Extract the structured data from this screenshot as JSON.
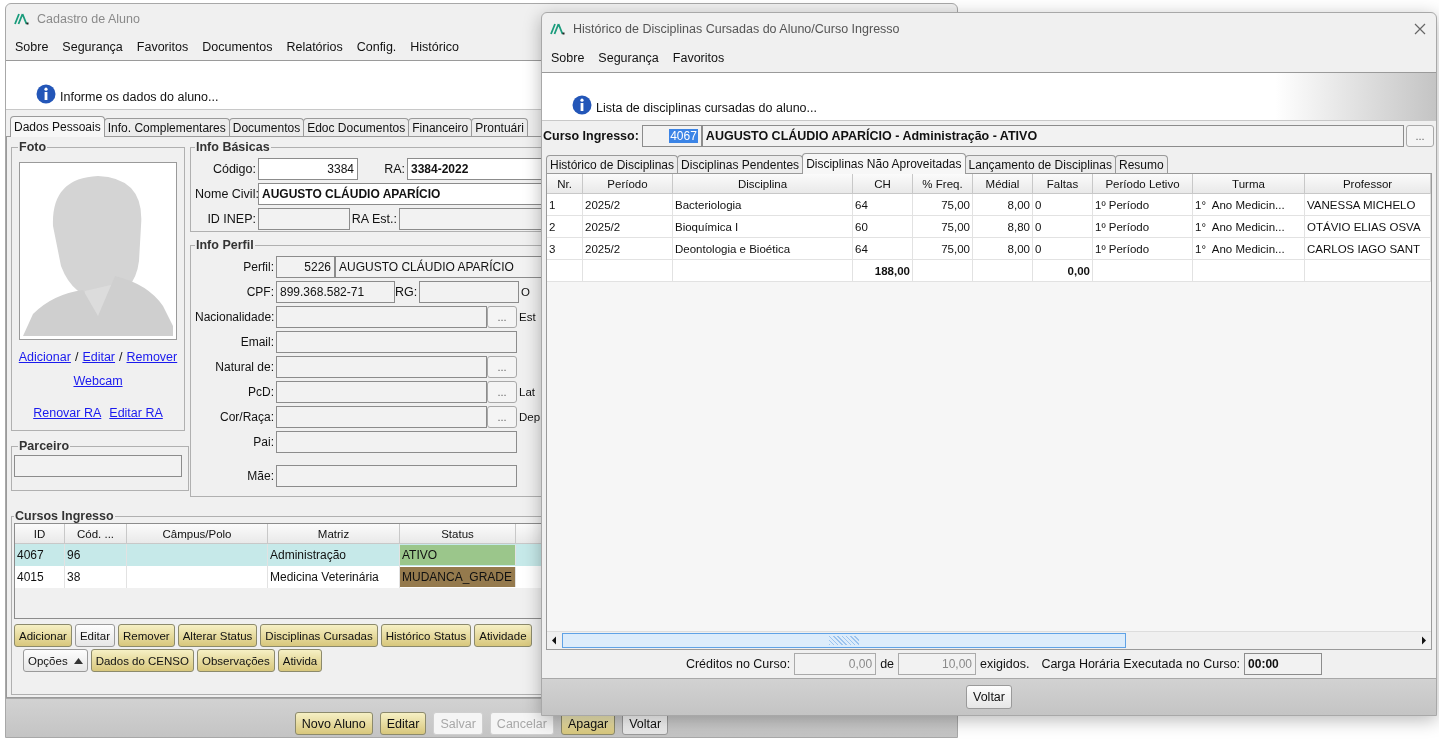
{
  "main_window": {
    "title": "Cadastro de Aluno",
    "menu": [
      "Sobre",
      "Segurança",
      "Favoritos",
      "Documentos",
      "Relatórios",
      "Config.",
      "Histórico"
    ],
    "info_message": "Informe os dados do aluno...",
    "tabs": [
      {
        "label": "Dados Pessoais",
        "selected": true
      },
      {
        "label": "Info. Complementares",
        "selected": false
      },
      {
        "label": "Documentos",
        "selected": false
      },
      {
        "label": "Edoc Documentos",
        "selected": false
      },
      {
        "label": "Financeiro",
        "selected": false
      },
      {
        "label": "Prontuári",
        "selected": false
      }
    ],
    "foto": {
      "title": "Foto",
      "photo_links": [
        {
          "kind": "link",
          "text": "Adicionar"
        },
        {
          "kind": "separator",
          "text": "/"
        },
        {
          "kind": "link",
          "text": "Editar"
        },
        {
          "kind": "separator",
          "text": "/"
        },
        {
          "kind": "link",
          "text": "Remover"
        }
      ],
      "webcam_link": "Webcam",
      "ra_links": [
        "Renovar RA",
        "Editar RA"
      ]
    },
    "parceiro": {
      "title": "Parceiro"
    },
    "info_basicas": {
      "title": "Info Básicas",
      "codigo": {
        "label": "Código:",
        "value": "3384"
      },
      "ra": {
        "label": "RA:",
        "value": "3384-2022"
      },
      "nome_civil": {
        "label": "Nome Civil:",
        "value": "AUGUSTO CLÁUDIO APARÍCIO"
      },
      "id_inep": {
        "label": "ID INEP:"
      },
      "ra_est": {
        "label": "RA Est.:"
      }
    },
    "info_perfil": {
      "title": "Info Perfil",
      "perfil": {
        "label": "Perfil:",
        "code": "5226",
        "name": "AUGUSTO CLÁUDIO APARÍCIO"
      },
      "cpf": {
        "label": "CPF:",
        "value": "899.368.582-71"
      },
      "rg": {
        "label": "RG:",
        "side_label": "O"
      },
      "rows": [
        {
          "kind": "lookup",
          "label": "Nacionalidade:",
          "button": "...",
          "side_label": "Est"
        },
        {
          "kind": "text",
          "label": "Email:"
        },
        {
          "kind": "lookup",
          "label": "Natural de:",
          "button": "..."
        },
        {
          "kind": "lookup",
          "label": "PcD:",
          "button": "...",
          "side_label": "Lat"
        },
        {
          "kind": "lookup",
          "label": "Cor/Raça:",
          "button": "...",
          "side_label": "Dep"
        },
        {
          "kind": "text",
          "label": "Pai:"
        },
        {
          "kind": "text",
          "label": "Mãe:"
        }
      ]
    },
    "cursos_ingresso": {
      "title": "Cursos Ingresso",
      "columns": [
        "ID",
        "Cód. ...",
        "Câmpus/Polo",
        "Matriz",
        "Status"
      ],
      "rows": [
        {
          "id": "4067",
          "cod": "96",
          "matriz": "Administração",
          "status": "ATIVO",
          "color": "#9bc68b",
          "selected": true
        },
        {
          "id": "4015",
          "cod": "38",
          "matriz": "Medicina Veterinária",
          "status": "MUDANCA_GRADE",
          "color": "#957a4d",
          "selected": false
        }
      ],
      "button_rows": [
        [
          {
            "label": "Adicionar",
            "kind": "gold"
          },
          {
            "label": "Editar",
            "kind": "plain"
          },
          {
            "label": "Remover",
            "kind": "gold"
          },
          {
            "label": "Alterar Status",
            "kind": "gold"
          },
          {
            "label": "Disciplinas Cursadas",
            "kind": "gold"
          },
          {
            "label": "Histórico Status",
            "kind": "gold"
          },
          {
            "label": "Atividade",
            "kind": "gold"
          }
        ],
        [
          {
            "label": "Opções",
            "kind": "menu"
          },
          {
            "label": "Dados do CENSO",
            "kind": "gold"
          },
          {
            "label": "Observações",
            "kind": "gold"
          },
          {
            "label": "Ativida",
            "kind": "gold"
          }
        ]
      ]
    },
    "bottom_buttons": [
      {
        "label": "Novo Aluno",
        "kind": "gold",
        "disabled": false
      },
      {
        "label": "Editar",
        "kind": "gold",
        "disabled": false
      },
      {
        "label": "Salvar",
        "kind": "plain",
        "disabled": true
      },
      {
        "label": "Cancelar",
        "kind": "plain",
        "disabled": true
      },
      {
        "label": "Apagar",
        "kind": "gold",
        "disabled": false
      },
      {
        "label": "Voltar",
        "kind": "plain",
        "disabled": false
      }
    ]
  },
  "history_window": {
    "title": "Histórico de Disciplinas Cursadas do Aluno/Curso Ingresso",
    "menu": [
      "Sobre",
      "Segurança",
      "Favoritos"
    ],
    "info_message": "Lista de disciplinas cursadas do aluno...",
    "curso_ingresso": {
      "label": "Curso Ingresso:",
      "code": "4067",
      "code_selected": true,
      "description": "AUGUSTO CLÁUDIO APARÍCIO - Administração - ATIVO",
      "button": "..."
    },
    "tabs": [
      {
        "label": "Histórico de Disciplinas",
        "selected": false
      },
      {
        "label": "Disciplinas Pendentes",
        "selected": false
      },
      {
        "label": "Disciplinas Não Aproveitadas",
        "selected": true
      },
      {
        "label": "Lançamento de Disciplinas",
        "selected": false
      },
      {
        "label": "Resumo",
        "selected": false
      }
    ],
    "table": {
      "columns": [
        "Nr.",
        "Período",
        "Disciplina",
        "CH",
        "% Freq.",
        "Médial",
        "Faltas",
        "Período Letivo",
        "Turma",
        "Professor"
      ],
      "rows": [
        [
          "1",
          "2025/2",
          "Bacteriologia",
          "64",
          "75,00",
          "8,00",
          "0",
          "1º Período",
          "1°  Ano Medicin...",
          "VANESSA MICHELO"
        ],
        [
          "2",
          "2025/2",
          "Bioquímica I",
          "60",
          "75,00",
          "8,80",
          "0",
          "1º Período",
          "1°  Ano Medicin...",
          "OTÁVIO ELIAS OSVA"
        ],
        [
          "3",
          "2025/2",
          "Deontologia e Bioética",
          "64",
          "75,00",
          "8,00",
          "0",
          "1º Período",
          "1°  Ano Medicin...",
          "CARLOS IAGO SANT"
        ]
      ],
      "totals": {
        "ch": "188,00",
        "faltas": "0,00"
      }
    },
    "footer": {
      "creditos_label": "Créditos no Curso:",
      "creditos_value": "0,00",
      "de_label": "de",
      "exigidos_value": "10,00",
      "exigidos_label": "exigidos.",
      "carga_label": "Carga Horária Executada no Curso:",
      "carga_value": "00:00"
    },
    "close_button": "Voltar"
  }
}
